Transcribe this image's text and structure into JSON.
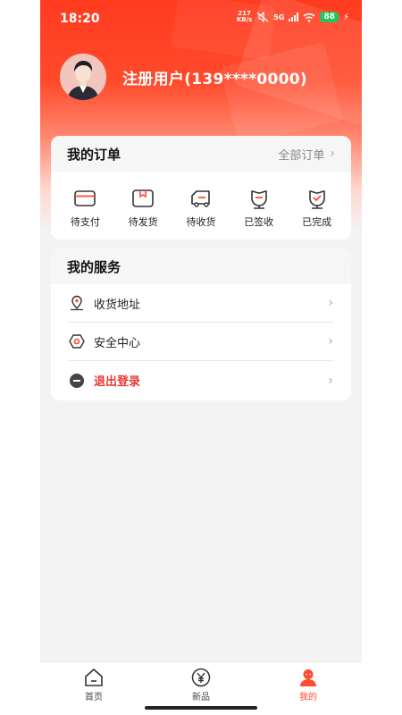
{
  "status": {
    "time": "18:20",
    "net_speed_top": "217",
    "net_speed_bottom": "KB/s",
    "network": "5G",
    "battery": "88",
    "icons": [
      "mute-icon",
      "signal-icon",
      "wifi-icon",
      "charging-icon"
    ]
  },
  "profile": {
    "username": "注册用户(139****0000)",
    "avatar_icon": "user-avatar"
  },
  "orders": {
    "title": "我的订单",
    "all_label": "全部订单",
    "items": [
      {
        "label": "待支付",
        "icon": "card-icon"
      },
      {
        "label": "待发货",
        "icon": "box-icon"
      },
      {
        "label": "待收货",
        "icon": "truck-icon"
      },
      {
        "label": "已签收",
        "icon": "signed-icon"
      },
      {
        "label": "已完成",
        "icon": "completed-icon"
      }
    ]
  },
  "services": {
    "title": "我的服务",
    "items": [
      {
        "label": "收货地址",
        "icon": "location-pin-icon"
      },
      {
        "label": "安全中心",
        "icon": "shield-hex-icon"
      },
      {
        "label": "退出登录",
        "icon": "minus-circle-icon",
        "color": "#e53935"
      }
    ]
  },
  "tabbar": {
    "items": [
      {
        "label": "首页",
        "icon": "home-icon",
        "active": false
      },
      {
        "label": "新品",
        "icon": "yen-icon",
        "active": false
      },
      {
        "label": "我的",
        "icon": "person-icon",
        "active": true
      }
    ]
  },
  "colors": {
    "accent": "#ff4a2b",
    "logout": "#e53935",
    "background": "#f3f3f3"
  }
}
